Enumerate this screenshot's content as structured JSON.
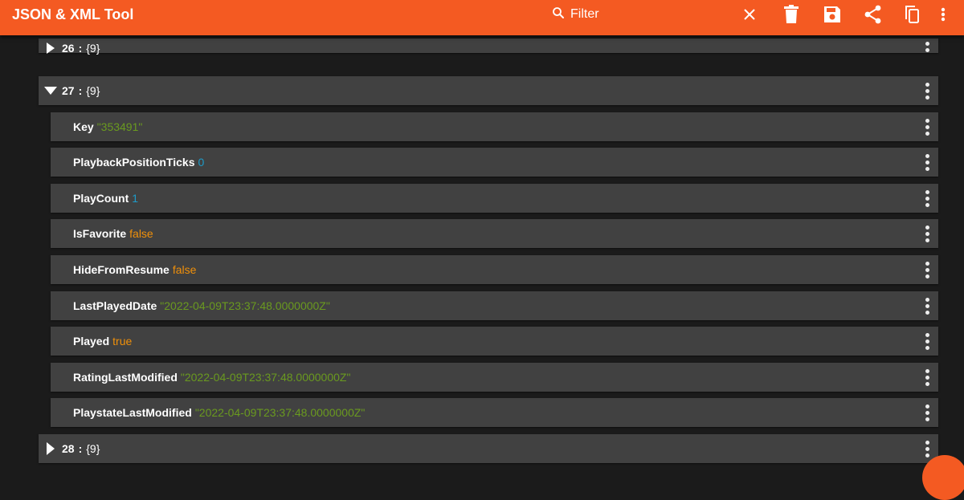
{
  "app": {
    "title": "JSON & XML Tool",
    "accent": "#f45a22",
    "background": "#1b1b1b",
    "row_color": "#414141"
  },
  "toolbar": {
    "filter_placeholder": "Filter",
    "icons": [
      "search-icon",
      "close-icon",
      "delete-icon",
      "save-icon",
      "share-icon",
      "copy-icon",
      "more-vert-icon"
    ]
  },
  "tree": {
    "separator": ":",
    "item26": {
      "key": "26",
      "value": "{9}",
      "state": "collapsed"
    },
    "item27": {
      "key": "27",
      "value": "{9}",
      "state": "expanded",
      "children": [
        {
          "key": "Key",
          "value": "\"353491\"",
          "type": "string"
        },
        {
          "key": "PlaybackPositionTicks",
          "value": "0",
          "type": "number"
        },
        {
          "key": "PlayCount",
          "value": "1",
          "type": "number"
        },
        {
          "key": "IsFavorite",
          "value": "false",
          "type": "bool"
        },
        {
          "key": "HideFromResume",
          "value": "false",
          "type": "bool"
        },
        {
          "key": "LastPlayedDate",
          "value": "\"2022-04-09T23:37:48.0000000Z\"",
          "type": "string"
        },
        {
          "key": "Played",
          "value": "true",
          "type": "bool"
        },
        {
          "key": "RatingLastModified",
          "value": "\"2022-04-09T23:37:48.0000000Z\"",
          "type": "string"
        },
        {
          "key": "PlaystateLastModified",
          "value": "\"2022-04-09T23:37:48.0000000Z\"",
          "type": "string"
        }
      ]
    },
    "item28": {
      "key": "28",
      "value": "{9}",
      "state": "collapsed"
    }
  },
  "colors": {
    "string": "#6a9a1f",
    "number": "#1e9bc9",
    "bool": "#f0900a"
  }
}
